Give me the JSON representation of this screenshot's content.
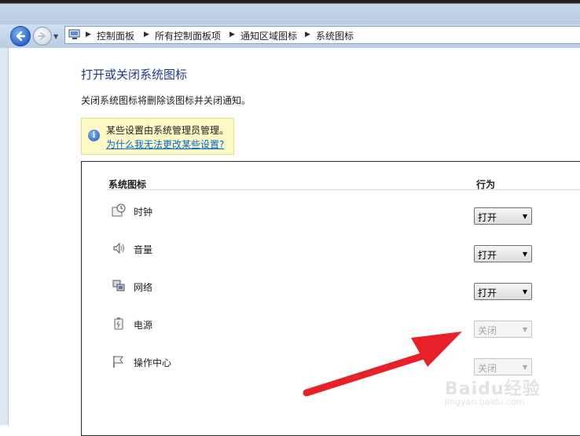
{
  "breadcrumb": [
    "控制面板",
    "所有控制面板项",
    "通知区域图标",
    "系统图标"
  ],
  "page": {
    "title": "打开或关闭系统图标",
    "description": "关闭系统图标将删除该图标并关闭通知。"
  },
  "info": {
    "message": "某些设置由系统管理员管理。",
    "link": "为什么我无法更改某些设置?"
  },
  "table": {
    "col_icon": "系统图标",
    "col_behavior": "行为",
    "rows": [
      {
        "icon": "clock-icon",
        "label": "时钟",
        "value": "打开",
        "enabled": true
      },
      {
        "icon": "speaker-icon",
        "label": "音量",
        "value": "打开",
        "enabled": true
      },
      {
        "icon": "network-icon",
        "label": "网络",
        "value": "打开",
        "enabled": true
      },
      {
        "icon": "power-icon",
        "label": "电源",
        "value": "关闭",
        "enabled": false
      },
      {
        "icon": "flag-icon",
        "label": "操作中心",
        "value": "关闭",
        "enabled": false
      }
    ]
  },
  "watermark": {
    "brand": "Baidu经验",
    "url": "jingyan.baidu.com"
  },
  "colors": {
    "accent_title": "#1e3a8a",
    "link": "#0066cc",
    "arrow": "#e8202a",
    "info_bg": "#fdf8c6"
  }
}
